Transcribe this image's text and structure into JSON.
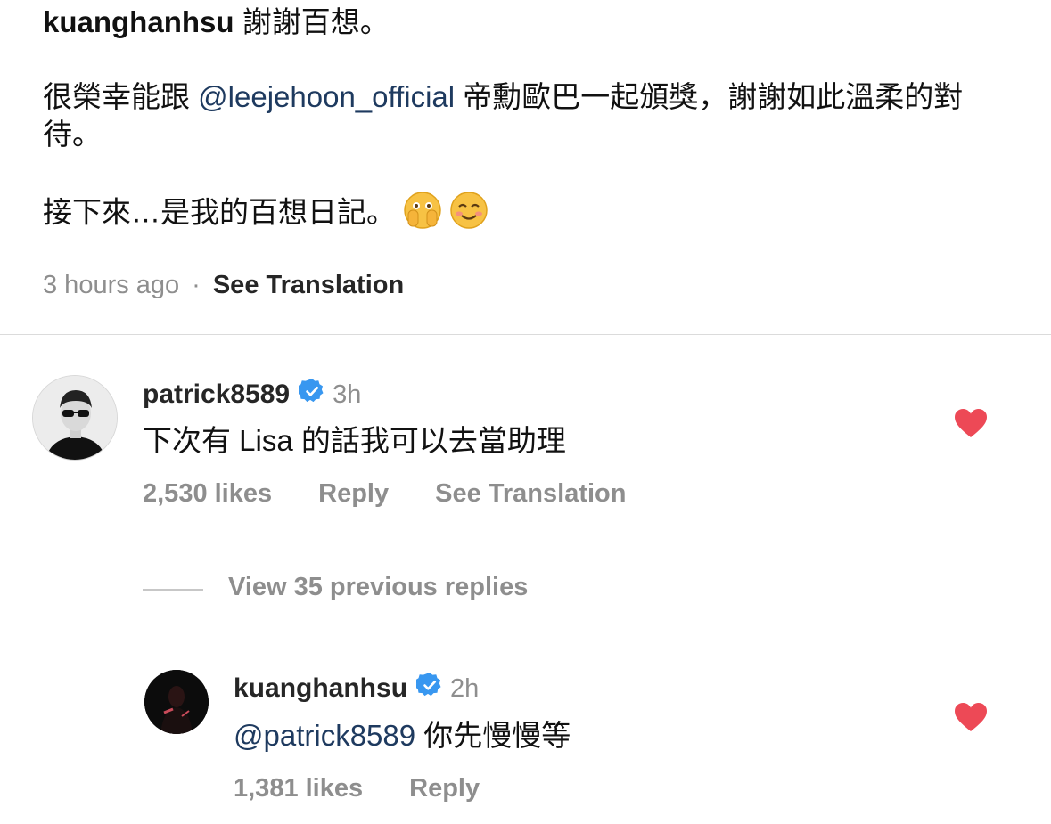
{
  "post": {
    "username": "kuanghanhsu",
    "caption_line1": " 謝謝百想。",
    "caption_line2_before": "很榮幸能跟 ",
    "caption_mention": "@leejehoon_official",
    "caption_line2_after": " 帝勳歐巴一起頒獎，謝謝如此溫柔的對待。",
    "caption_line3": "接下來…是我的百想日記。",
    "emojis": [
      "face-with-open-eyes-and-hand-over-mouth",
      "smiling-face"
    ],
    "time_ago": "3 hours ago",
    "separator": "·",
    "see_translation": "See Translation"
  },
  "comments": [
    {
      "username": "patrick8589",
      "verified": true,
      "time": "3h",
      "text": "下次有 Lisa 的話我可以去當助理",
      "likes": "2,530 likes",
      "reply": "Reply",
      "see_translation": "See Translation"
    }
  ],
  "view_replies": "View 35 previous replies",
  "reply": {
    "username": "kuanghanhsu",
    "verified": true,
    "time": "2h",
    "mention": "@patrick8589",
    "text": " 你先慢慢等",
    "likes": "1,381 likes",
    "reply": "Reply"
  },
  "colors": {
    "heart": "#ed4956",
    "verified": "#3897f0",
    "mention": "#1e3a5f",
    "muted": "#8e8e8e"
  }
}
